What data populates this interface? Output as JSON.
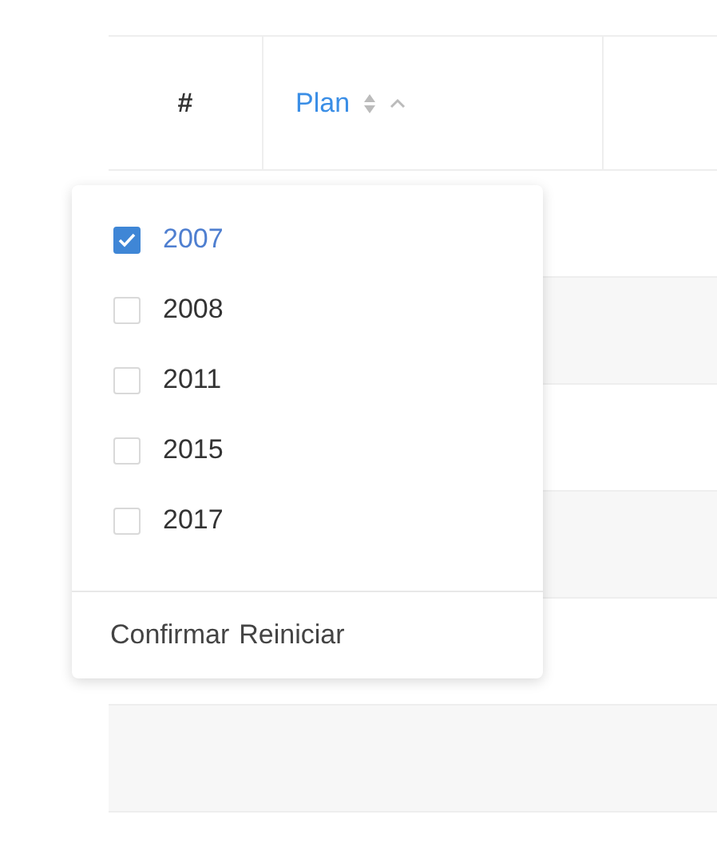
{
  "table": {
    "columns": [
      {
        "label": "#",
        "filtered": false
      },
      {
        "label": "Plan",
        "filtered": true
      }
    ]
  },
  "filter_dropdown": {
    "options": [
      {
        "label": "2007",
        "checked": true
      },
      {
        "label": "2008",
        "checked": false
      },
      {
        "label": "2011",
        "checked": false
      },
      {
        "label": "2015",
        "checked": false
      },
      {
        "label": "2017",
        "checked": false
      }
    ],
    "buttons": [
      "Confirmar",
      "Reiniciar"
    ]
  }
}
